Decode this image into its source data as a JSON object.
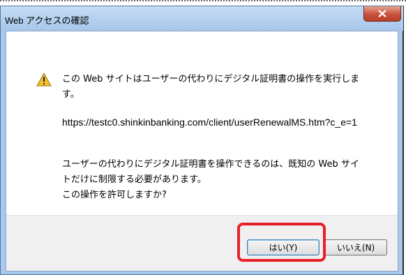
{
  "dialog": {
    "title": "Web アクセスの確認",
    "icons": {
      "warning": "warning-icon",
      "close": "close-icon"
    },
    "message_line1": "この Web サイトはユーザーの代わりにデジタル証明書の操作を実行します。",
    "url": "https://testc0.shinkinbanking.com/client/userRenewalMS.htm?c_e=1",
    "message_line2": "ユーザーの代わりにデジタル証明書を操作できるのは、既知の Web サイトだけに制限する必要があります。",
    "message_line3": "この操作を許可しますか?",
    "buttons": {
      "yes": "はい(Y)",
      "no": "いいえ(N)"
    }
  },
  "colors": {
    "highlight": "#e8202a",
    "titlebar": "#a9c8ec",
    "close_button": "#c7513b"
  }
}
